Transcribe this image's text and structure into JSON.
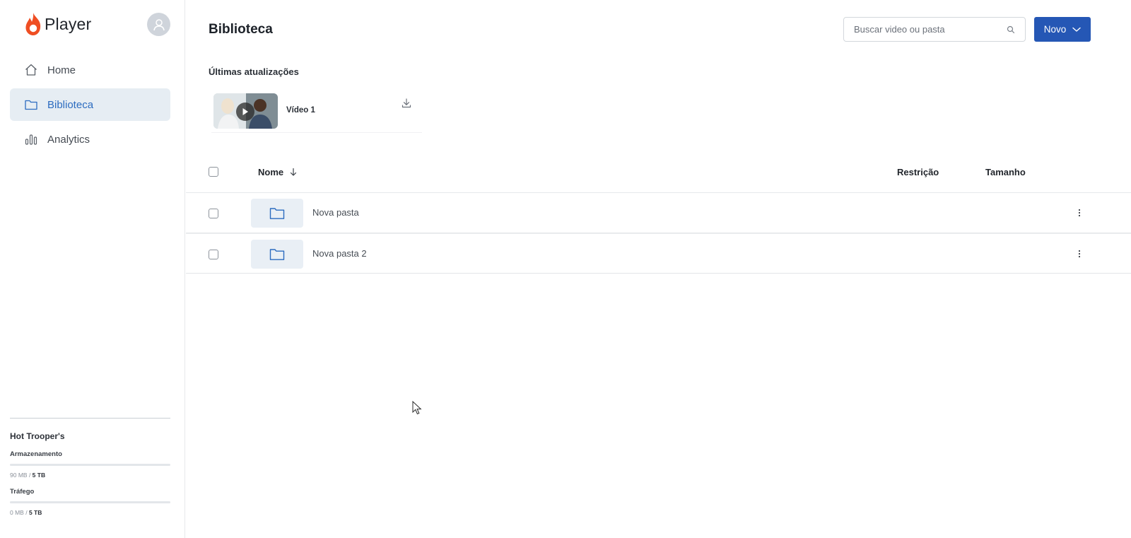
{
  "app": {
    "name": "Player",
    "brand_color": "#ef4e23"
  },
  "sidebar": {
    "items": [
      {
        "label": "Home",
        "icon": "home-icon",
        "active": false
      },
      {
        "label": "Biblioteca",
        "icon": "folder-icon",
        "active": true
      },
      {
        "label": "Analytics",
        "icon": "analytics-icon",
        "active": false
      }
    ],
    "account": {
      "name": "Hot Trooper's",
      "storage": {
        "label": "Armazenamento",
        "used": "90 MB",
        "separator": " / ",
        "total": "5 TB",
        "fraction": 0.0
      },
      "traffic": {
        "label": "Tráfego",
        "used": "0 MB",
        "separator": " / ",
        "total": "5 TB",
        "fraction": 0.0
      }
    }
  },
  "header": {
    "title": "Biblioteca",
    "search_placeholder": "Buscar video ou pasta",
    "new_button": "Novo",
    "accent_color": "#2557b5"
  },
  "recent": {
    "title": "Últimas atualizações",
    "items": [
      {
        "title": "Vídeo 1"
      }
    ]
  },
  "table": {
    "columns": {
      "name": "Nome",
      "restriction": "Restrição",
      "size": "Tamanho"
    },
    "rows": [
      {
        "name": "Nova pasta",
        "type": "folder"
      },
      {
        "name": "Nova pasta 2",
        "type": "folder"
      }
    ]
  }
}
